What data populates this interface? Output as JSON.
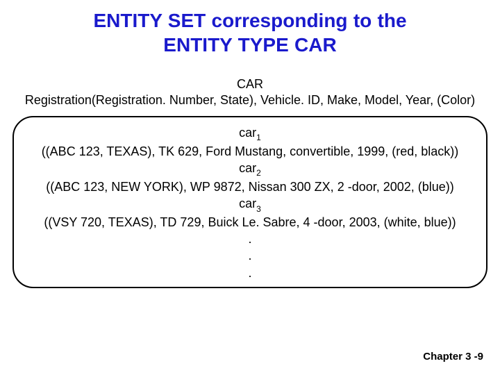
{
  "heading": {
    "line1": "ENTITY SET corresponding to the",
    "line2": "ENTITY TYPE CAR"
  },
  "schema": {
    "name": "CAR",
    "attrs": "Registration(Registration. Number, State), Vehicle. ID, Make, Model, Year, (Color)"
  },
  "entities": [
    {
      "label_prefix": "car",
      "label_sub": "1",
      "tuple": "((ABC 123, TEXAS), TK 629, Ford Mustang, convertible, 1999, (red, black))"
    },
    {
      "label_prefix": "car",
      "label_sub": "2",
      "tuple": "((ABC 123, NEW YORK), WP 9872, Nissan 300 ZX, 2 -door, 2002, (blue))"
    },
    {
      "label_prefix": "car",
      "label_sub": "3",
      "tuple": "((VSY 720, TEXAS), TD 729, Buick Le. Sabre, 4 -door, 2003, (white, blue))"
    }
  ],
  "dots": [
    ".",
    ".",
    "."
  ],
  "footer": "Chapter 3 -9"
}
